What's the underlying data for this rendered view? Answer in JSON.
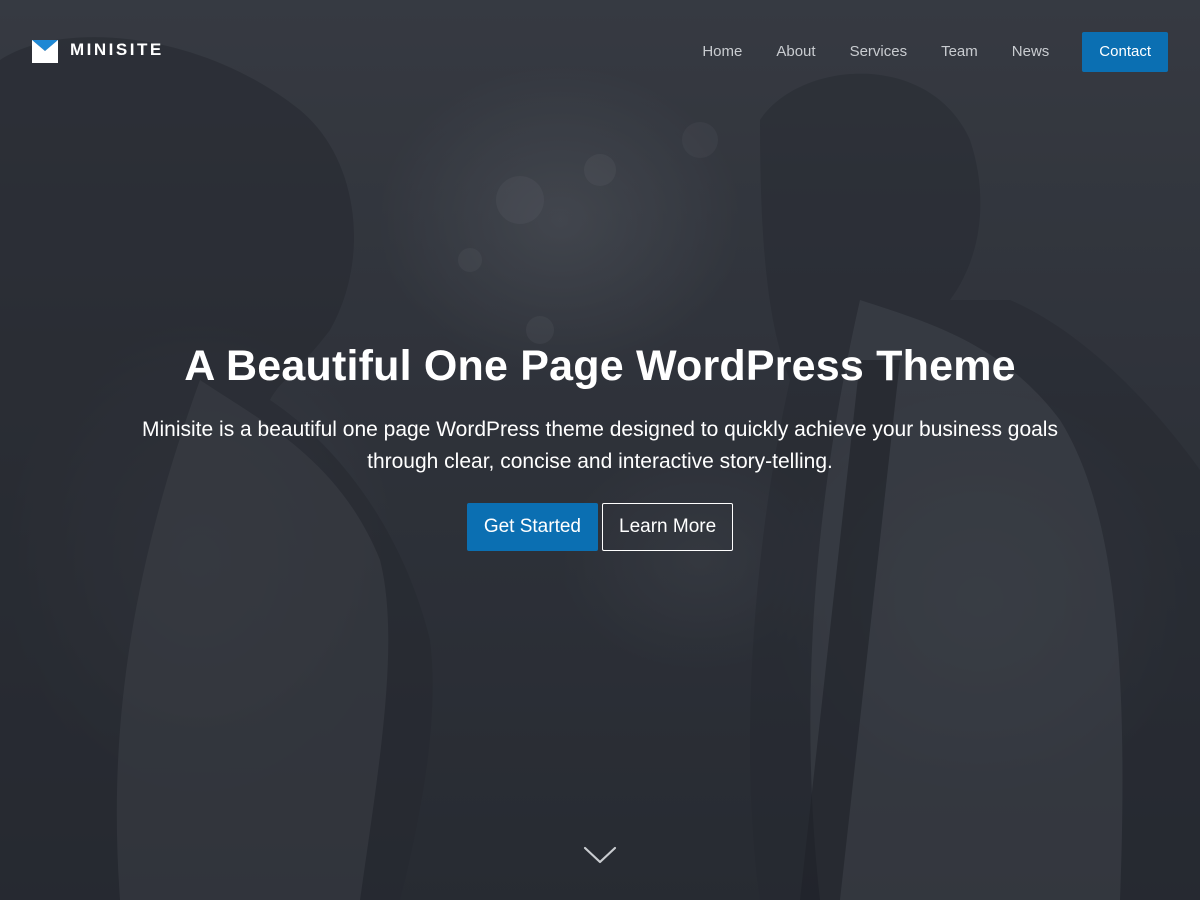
{
  "brand": {
    "name": "MINISITE",
    "logo_icon": "minisite-logo-icon",
    "accent_color": "#0b6fb2"
  },
  "nav": {
    "items": [
      {
        "label": "Home"
      },
      {
        "label": "About"
      },
      {
        "label": "Services"
      },
      {
        "label": "Team"
      },
      {
        "label": "News"
      }
    ],
    "cta_label": "Contact"
  },
  "hero": {
    "title": "A Beautiful One Page WordPress Theme",
    "subtitle": "Minisite is a beautiful one page WordPress theme designed to quickly achieve your business goals through clear, concise and interactive story-telling.",
    "primary_button": "Get Started",
    "secondary_button": "Learn More",
    "scroll_icon": "chevron-down-icon"
  }
}
